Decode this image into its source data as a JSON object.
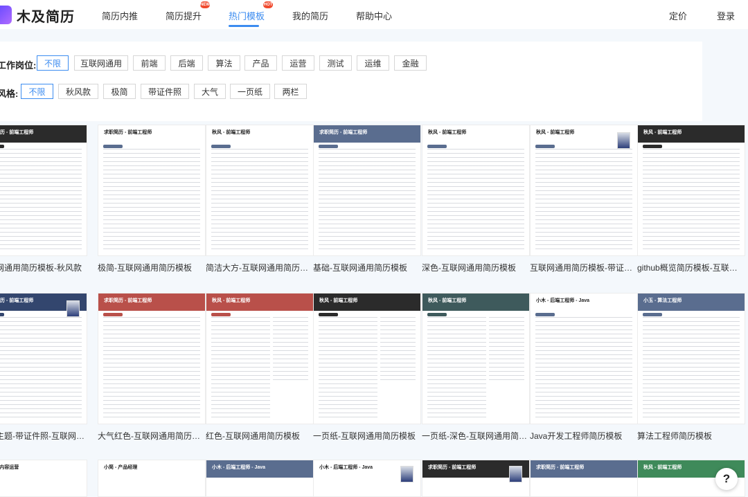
{
  "app": {
    "logo_text": "木及简历",
    "accent": "#3c8cf0"
  },
  "nav": {
    "items": [
      {
        "label": "简历内推"
      },
      {
        "label": "简历提升",
        "badge": "NEW"
      },
      {
        "label": "热门模板",
        "badge": "HOT",
        "active": true
      },
      {
        "label": "我的简历"
      },
      {
        "label": "帮助中心"
      }
    ],
    "pricing": "定价",
    "login": "登录"
  },
  "filters": {
    "position": {
      "label": "工作岗位:",
      "options": [
        "不限",
        "互联网通用",
        "前端",
        "后端",
        "算法",
        "产品",
        "运营",
        "测试",
        "运维",
        "金融"
      ],
      "selected": "不限"
    },
    "style": {
      "label": "风格:",
      "options": [
        "不限",
        "秋风款",
        "极简",
        "带证件照",
        "大气",
        "一页纸",
        "两栏"
      ],
      "selected": "不限"
    }
  },
  "templates": {
    "row1": [
      {
        "title": "互联网通用简历模板-秋风款",
        "thumb_title": "求职简历 - 前端工程师",
        "header": "#2b2b2b"
      },
      {
        "title": "极简-互联网通用简历模板",
        "thumb_title": "求职简历 - 前端工程师",
        "header": "light"
      },
      {
        "title": "简洁大方-互联网通用简历模板",
        "thumb_title": "秋风 - 前端工程师",
        "header": "light"
      },
      {
        "title": "基础-互联网通用简历模板",
        "thumb_title": "求职简历 - 前端工程师",
        "header": "#5a6d8f"
      },
      {
        "title": "深色-互联网通用简历模板",
        "thumb_title": "秋风 - 前端工程师",
        "header": "light"
      },
      {
        "title": "互联网通用简历模板-带证件照",
        "thumb_title": "秋风 - 前端工程师",
        "header": "light"
      },
      {
        "title": "github概览简历模板-互联网通用简历模板",
        "thumb_title": "秋风 - 前端工程师",
        "header": "#2b2b2b"
      }
    ],
    "row2": [
      {
        "title": "蓝色主题-带证件照-互联网通用简历模板",
        "thumb_title": "求职简历 - 前端工程师",
        "header": "#33466e"
      },
      {
        "title": "大气红色-互联网通用简历模板",
        "thumb_title": "求职简历 - 前端工程师",
        "header": "#b9504a"
      },
      {
        "title": "红色-互联网通用简历模板",
        "thumb_title": "秋风 - 前端工程师",
        "header": "#b9504a"
      },
      {
        "title": "一页纸-互联网通用简历模板",
        "thumb_title": "秋风 - 前端工程师",
        "header": "#2b2b2b"
      },
      {
        "title": "一页纸-深色-互联网通用简历模板",
        "thumb_title": "秋风 - 前端工程师",
        "header": "#3e5a5c"
      },
      {
        "title": "Java开发工程师简历模板",
        "thumb_title": "小木 - 后端工程师 - Java",
        "header": "light"
      },
      {
        "title": "算法工程师简历模板",
        "thumb_title": "小玉 - 算法工程师",
        "header": "#5a6d8f"
      }
    ],
    "row3": [
      {
        "thumb_title": "小及 - 内容运营",
        "header": "light"
      },
      {
        "thumb_title": "小简 - 产品经理",
        "header": "light"
      },
      {
        "thumb_title": "小木 - 后端工程师 - Java",
        "header": "#5a6d8f"
      },
      {
        "thumb_title": "小木 - 后端工程师 - Java",
        "header": "light"
      },
      {
        "thumb_title": "求职简历 - 前端工程师",
        "header": "#2b2b2b"
      },
      {
        "thumb_title": "求职简历 - 前端工程师",
        "header": "#5a6d8f"
      },
      {
        "thumb_title": "秋风 - 前端工程师",
        "header": "#3f8a5a"
      }
    ]
  },
  "help_label": "?"
}
